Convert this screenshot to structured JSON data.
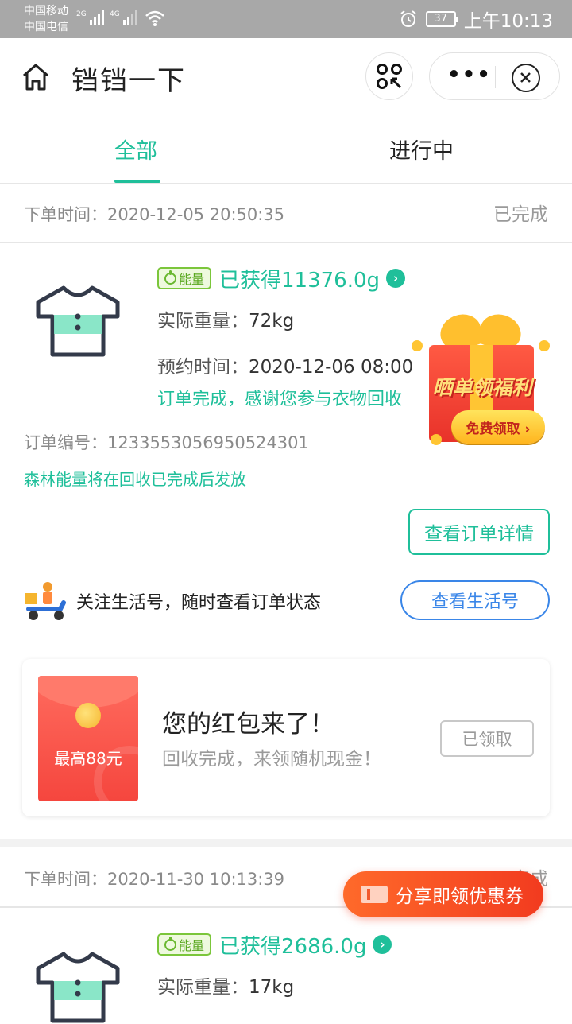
{
  "status_bar": {
    "carrier_1": "中国移动",
    "carrier_2": "中国电信",
    "net_1": "2G",
    "net_2": "4G",
    "battery": "37",
    "time": "上午10:13"
  },
  "app_bar": {
    "title": "铛铛一下"
  },
  "tabs": [
    {
      "label": "全部",
      "active": true
    },
    {
      "label": "进行中",
      "active": false
    }
  ],
  "orders": [
    {
      "time_label": "下单时间：",
      "time": "2020-12-05 20:50:35",
      "status": "已完成",
      "energy_badge": "能量",
      "energy_text": "已获得11376.0g",
      "weight_label": "实际重量：",
      "weight": "72kg",
      "appointment_label": "预约时间：",
      "appointment": "2020-12-06 08:00",
      "complete_msg": "订单完成，感谢您参与衣物回收",
      "order_no_label": "订单编号：",
      "order_no": "1233553056950524301",
      "forest_note": "森林能量将在回收已完成后发放",
      "detail_button": "查看订单详情"
    },
    {
      "time_label": "下单时间：",
      "time": "2020-11-30 10:13:39",
      "status": "已完成",
      "energy_badge": "能量",
      "energy_text": "已获得2686.0g",
      "weight_label": "实际重量：",
      "weight": "17kg"
    }
  ],
  "follow": {
    "text": "关注生活号，随时查看订单状态",
    "button": "查看生活号"
  },
  "red_packet": {
    "amount": "最高88元",
    "title": "您的红包来了！",
    "subtitle": "回收完成，来领随机现金！",
    "button": "已领取"
  },
  "gift_float": {
    "banner": "晒单领福利",
    "button": "免费领取 ›"
  },
  "share_float": {
    "label": "分享即领优惠券"
  },
  "colors": {
    "accent": "#1fbf9a",
    "link_blue": "#3a86e8",
    "share_orange": "#f23b1f"
  }
}
